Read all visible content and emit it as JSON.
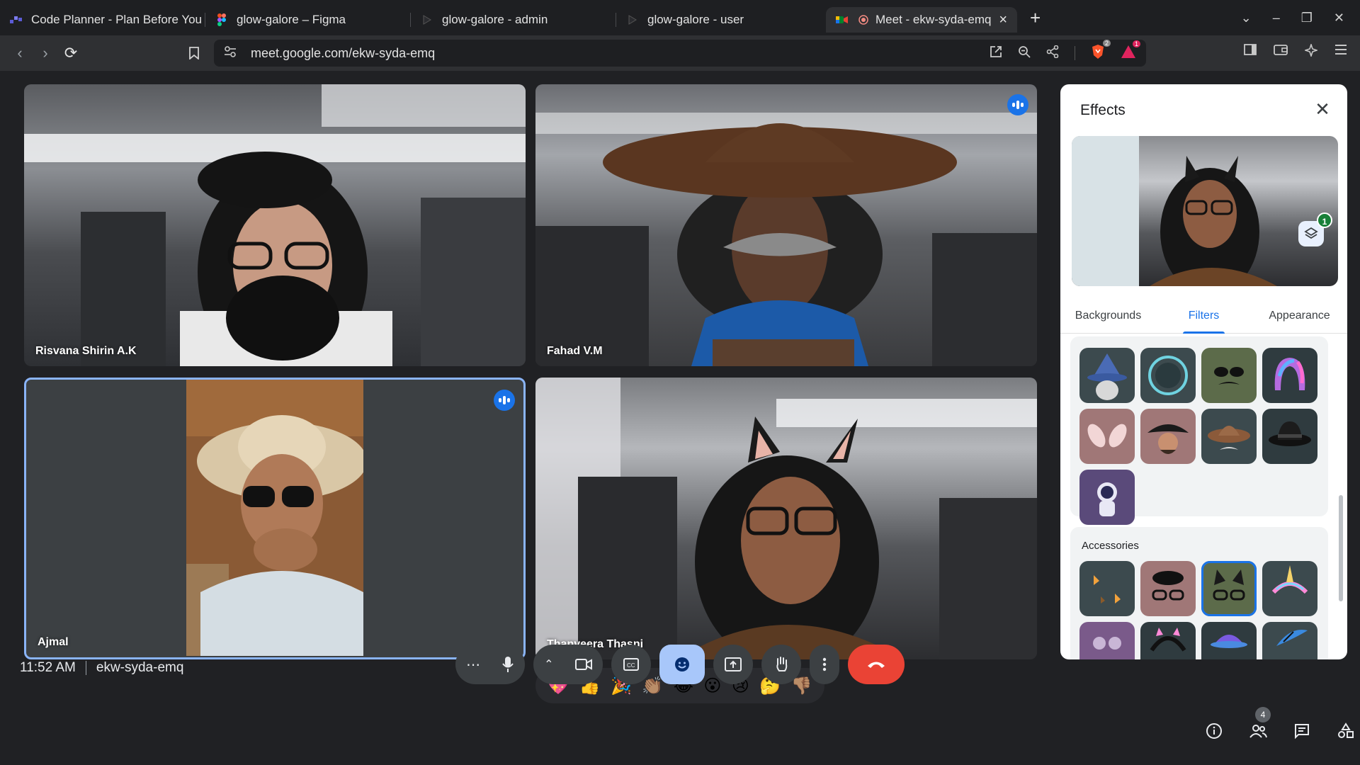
{
  "browser": {
    "tabs": [
      {
        "title": "Code Planner - Plan Before You"
      },
      {
        "title": "glow-galore – Figma"
      },
      {
        "title": "glow-galore - admin"
      },
      {
        "title": "glow-galore - user"
      },
      {
        "title": "Meet - ekw-syda-emq"
      }
    ],
    "url": "meet.google.com/ekw-syda-emq",
    "brave_badge": "2",
    "alert_badge": "1"
  },
  "participants": [
    {
      "name": "Risvana Shirin A.K"
    },
    {
      "name": "Fahad V.M"
    },
    {
      "name": "Ajmal"
    },
    {
      "name": "Thanveera Thasni"
    }
  ],
  "effects_panel": {
    "title": "Effects",
    "preview_badge": "1",
    "tabs": [
      "Backgrounds",
      "Filters",
      "Appearance"
    ],
    "active_tab": "Filters",
    "filters": [
      "wizard-hat-icon",
      "diving-helmet-icon",
      "sunglasses-mustache-icon",
      "rainbow-wig-icon",
      "bunny-ears-icon",
      "pirate-hat-icon",
      "cowboy-hat-icon",
      "fedora-icon",
      "astronaut-icon"
    ],
    "accessories_title": "Accessories",
    "accessories": [
      "butterflies-icon",
      "beret-glasses-icon",
      "cat-ears-glasses-icon",
      "unicorn-headband-icon",
      "round-glasses-icon",
      "cat-ear-headphones-icon",
      "cap-icon",
      "feather-icon"
    ]
  },
  "reactions": [
    "💖",
    "👍",
    "🎉",
    "👏🏽",
    "😂",
    "😮",
    "😢",
    "🤔",
    "👎🏽"
  ],
  "meeting": {
    "time": "11:52 AM",
    "code": "ekw-syda-emq",
    "people_count": "4"
  },
  "colors": {
    "accent": "#1a73e8",
    "end_call": "#ea4335",
    "active_control": "#a8c7fa"
  }
}
